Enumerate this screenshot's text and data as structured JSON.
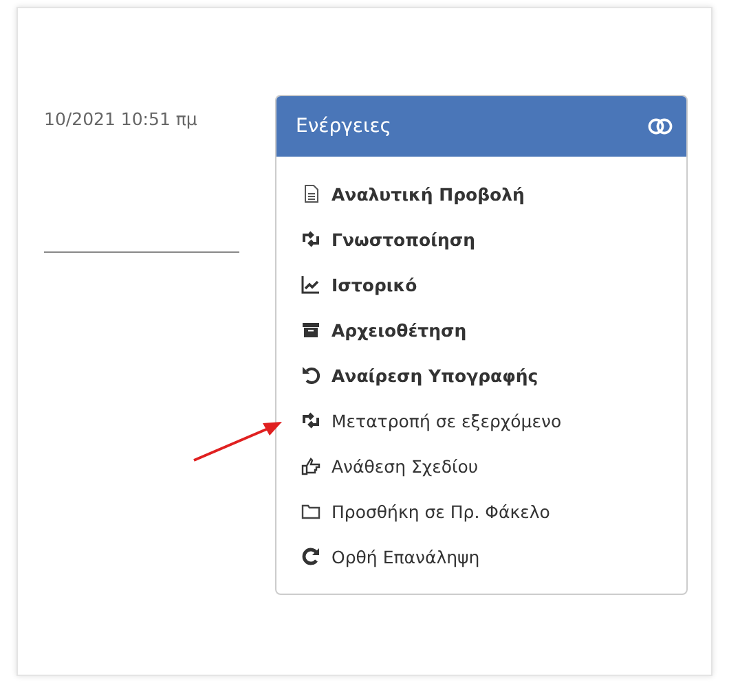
{
  "timestamp": "10/2021 10:51 πμ",
  "actions_panel": {
    "title": "Ενέργειες",
    "items": [
      {
        "label": "Αναλυτική Προβολή",
        "kind": "document"
      },
      {
        "label": "Γνωστοποίηση",
        "kind": "retweet"
      },
      {
        "label": "Ιστορικό",
        "kind": "chart"
      },
      {
        "label": "Αρχειοθέτηση",
        "kind": "archive"
      },
      {
        "label": "Αναίρεση Υπογραφής",
        "kind": "undo"
      },
      {
        "label": "Μετατροπή σε εξερχόμενο",
        "kind": "retweet"
      },
      {
        "label": "Ανάθεση Σχεδίου",
        "kind": "hand"
      },
      {
        "label": "Προσθήκη σε Πρ. Φάκελο",
        "kind": "folder"
      },
      {
        "label": "Ορθή Επανάληψη",
        "kind": "redo"
      }
    ]
  }
}
